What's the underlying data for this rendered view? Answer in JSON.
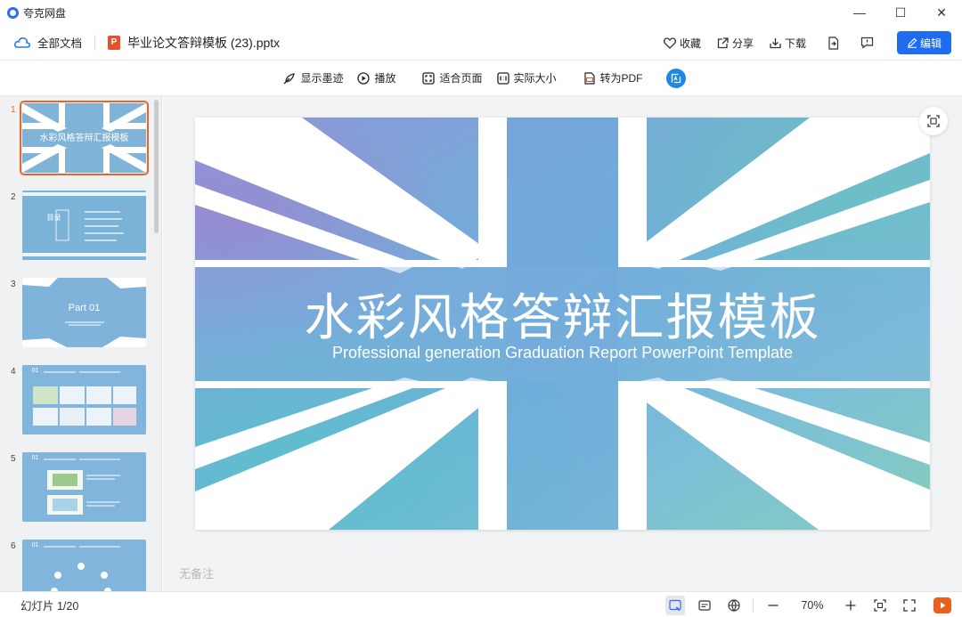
{
  "app": {
    "title": "夸克网盘"
  },
  "window_controls": {
    "minimize": "—",
    "maximize": "☐",
    "close": "✕"
  },
  "header": {
    "all_docs": "全部文档",
    "file_badge": "P",
    "file_name": "毕业论文答辩模板 (23).pptx",
    "favorite": "收藏",
    "share": "分享",
    "download": "下载",
    "edit": "编辑"
  },
  "toolbar": {
    "ink": "显示墨迹",
    "play": "播放",
    "fit_page": "适合页面",
    "actual_size": "实际大小",
    "to_pdf": "转为PDF"
  },
  "thumbnails": [
    {
      "num": "1",
      "title": "水彩风格答辩汇报模板"
    },
    {
      "num": "2",
      "title": "目录"
    },
    {
      "num": "3",
      "title": "Part 01"
    },
    {
      "num": "4",
      "title": "01"
    },
    {
      "num": "5",
      "title": "01"
    },
    {
      "num": "6",
      "title": "01"
    }
  ],
  "slide": {
    "title": "水彩风格答辩汇报模板",
    "subtitle": "Professional generation Graduation Report PowerPoint Template"
  },
  "notes": "无备注",
  "status": {
    "slide_counter": "幻灯片 1/20",
    "zoom": "70%"
  }
}
